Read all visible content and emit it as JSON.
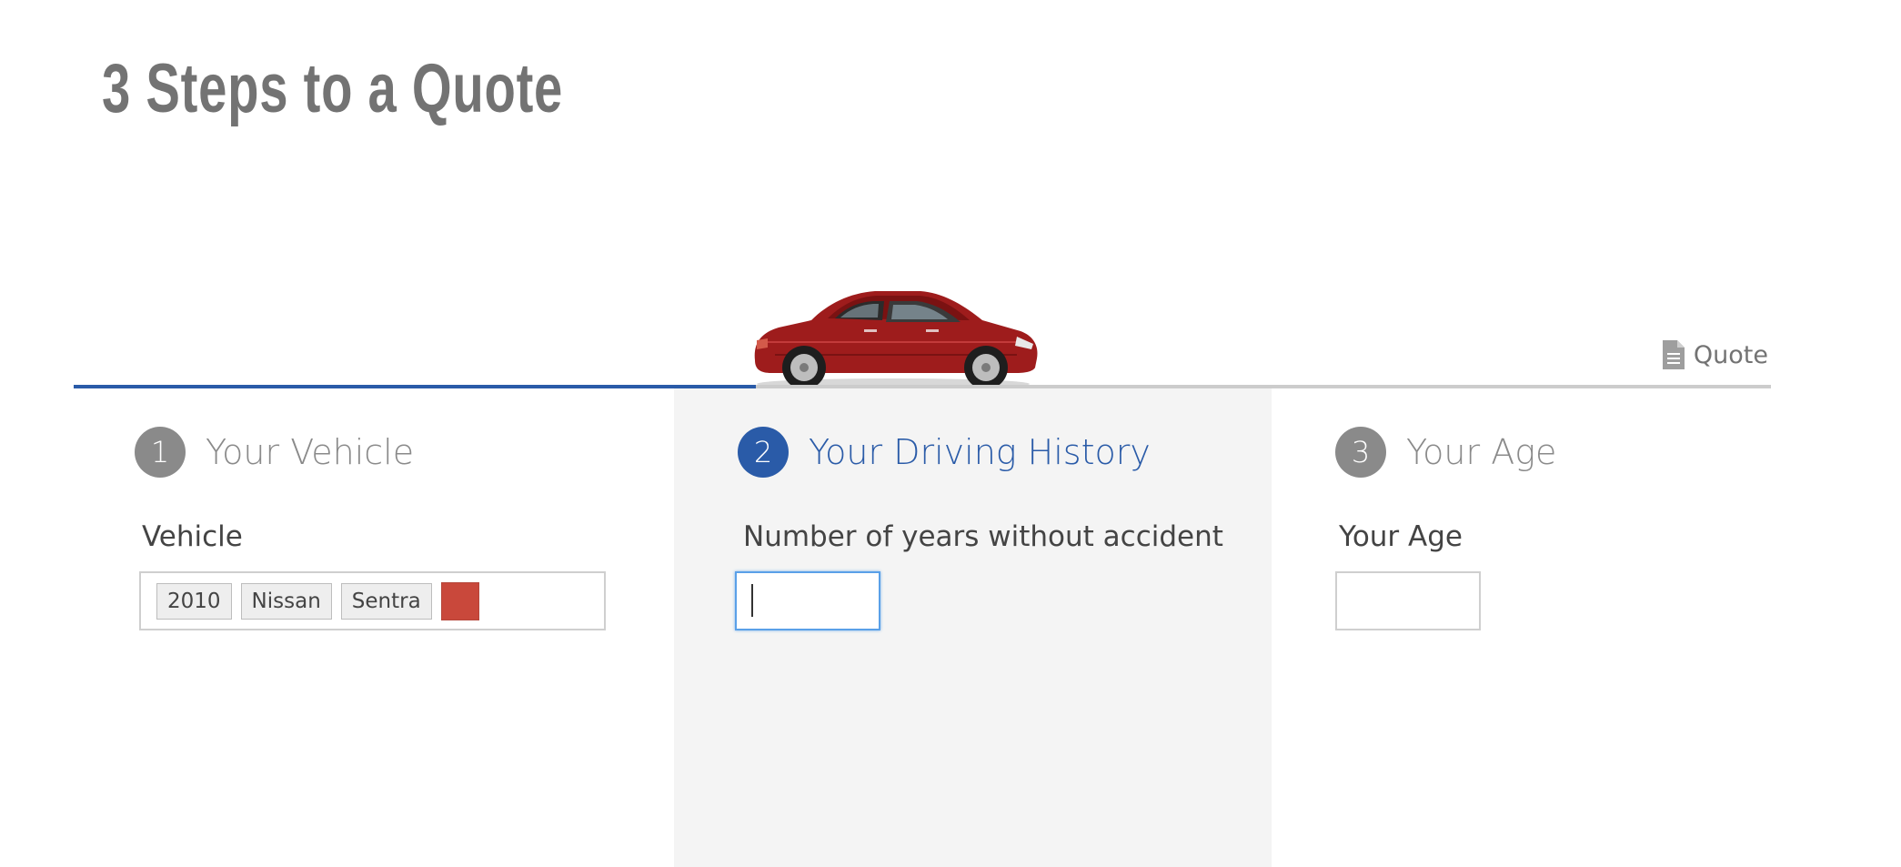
{
  "page": {
    "title": "3 Steps to a Quote"
  },
  "progress": {
    "current_step": 2,
    "total_steps": 3,
    "fill_fraction": 0.5
  },
  "quote_link": {
    "label": "Quote",
    "icon": "document-icon"
  },
  "steps": [
    {
      "number": "1",
      "title": "Your Vehicle",
      "state": "inactive",
      "field_label": "Vehicle",
      "vehicle": {
        "year": "2010",
        "make": "Nissan",
        "model": "Sentra",
        "color": "#c9483b"
      }
    },
    {
      "number": "2",
      "title": "Your Driving History",
      "state": "active",
      "field_label": "Number of years without accident",
      "input_value": ""
    },
    {
      "number": "3",
      "title": "Your Age",
      "state": "inactive",
      "field_label": "Your Age",
      "input_value": ""
    }
  ],
  "colors": {
    "accent": "#2a5ba8",
    "inactive": "#8a8a8a",
    "track": "#cccccc",
    "active_panel": "#f4f4f4",
    "car_body": "#9e1c1c"
  }
}
